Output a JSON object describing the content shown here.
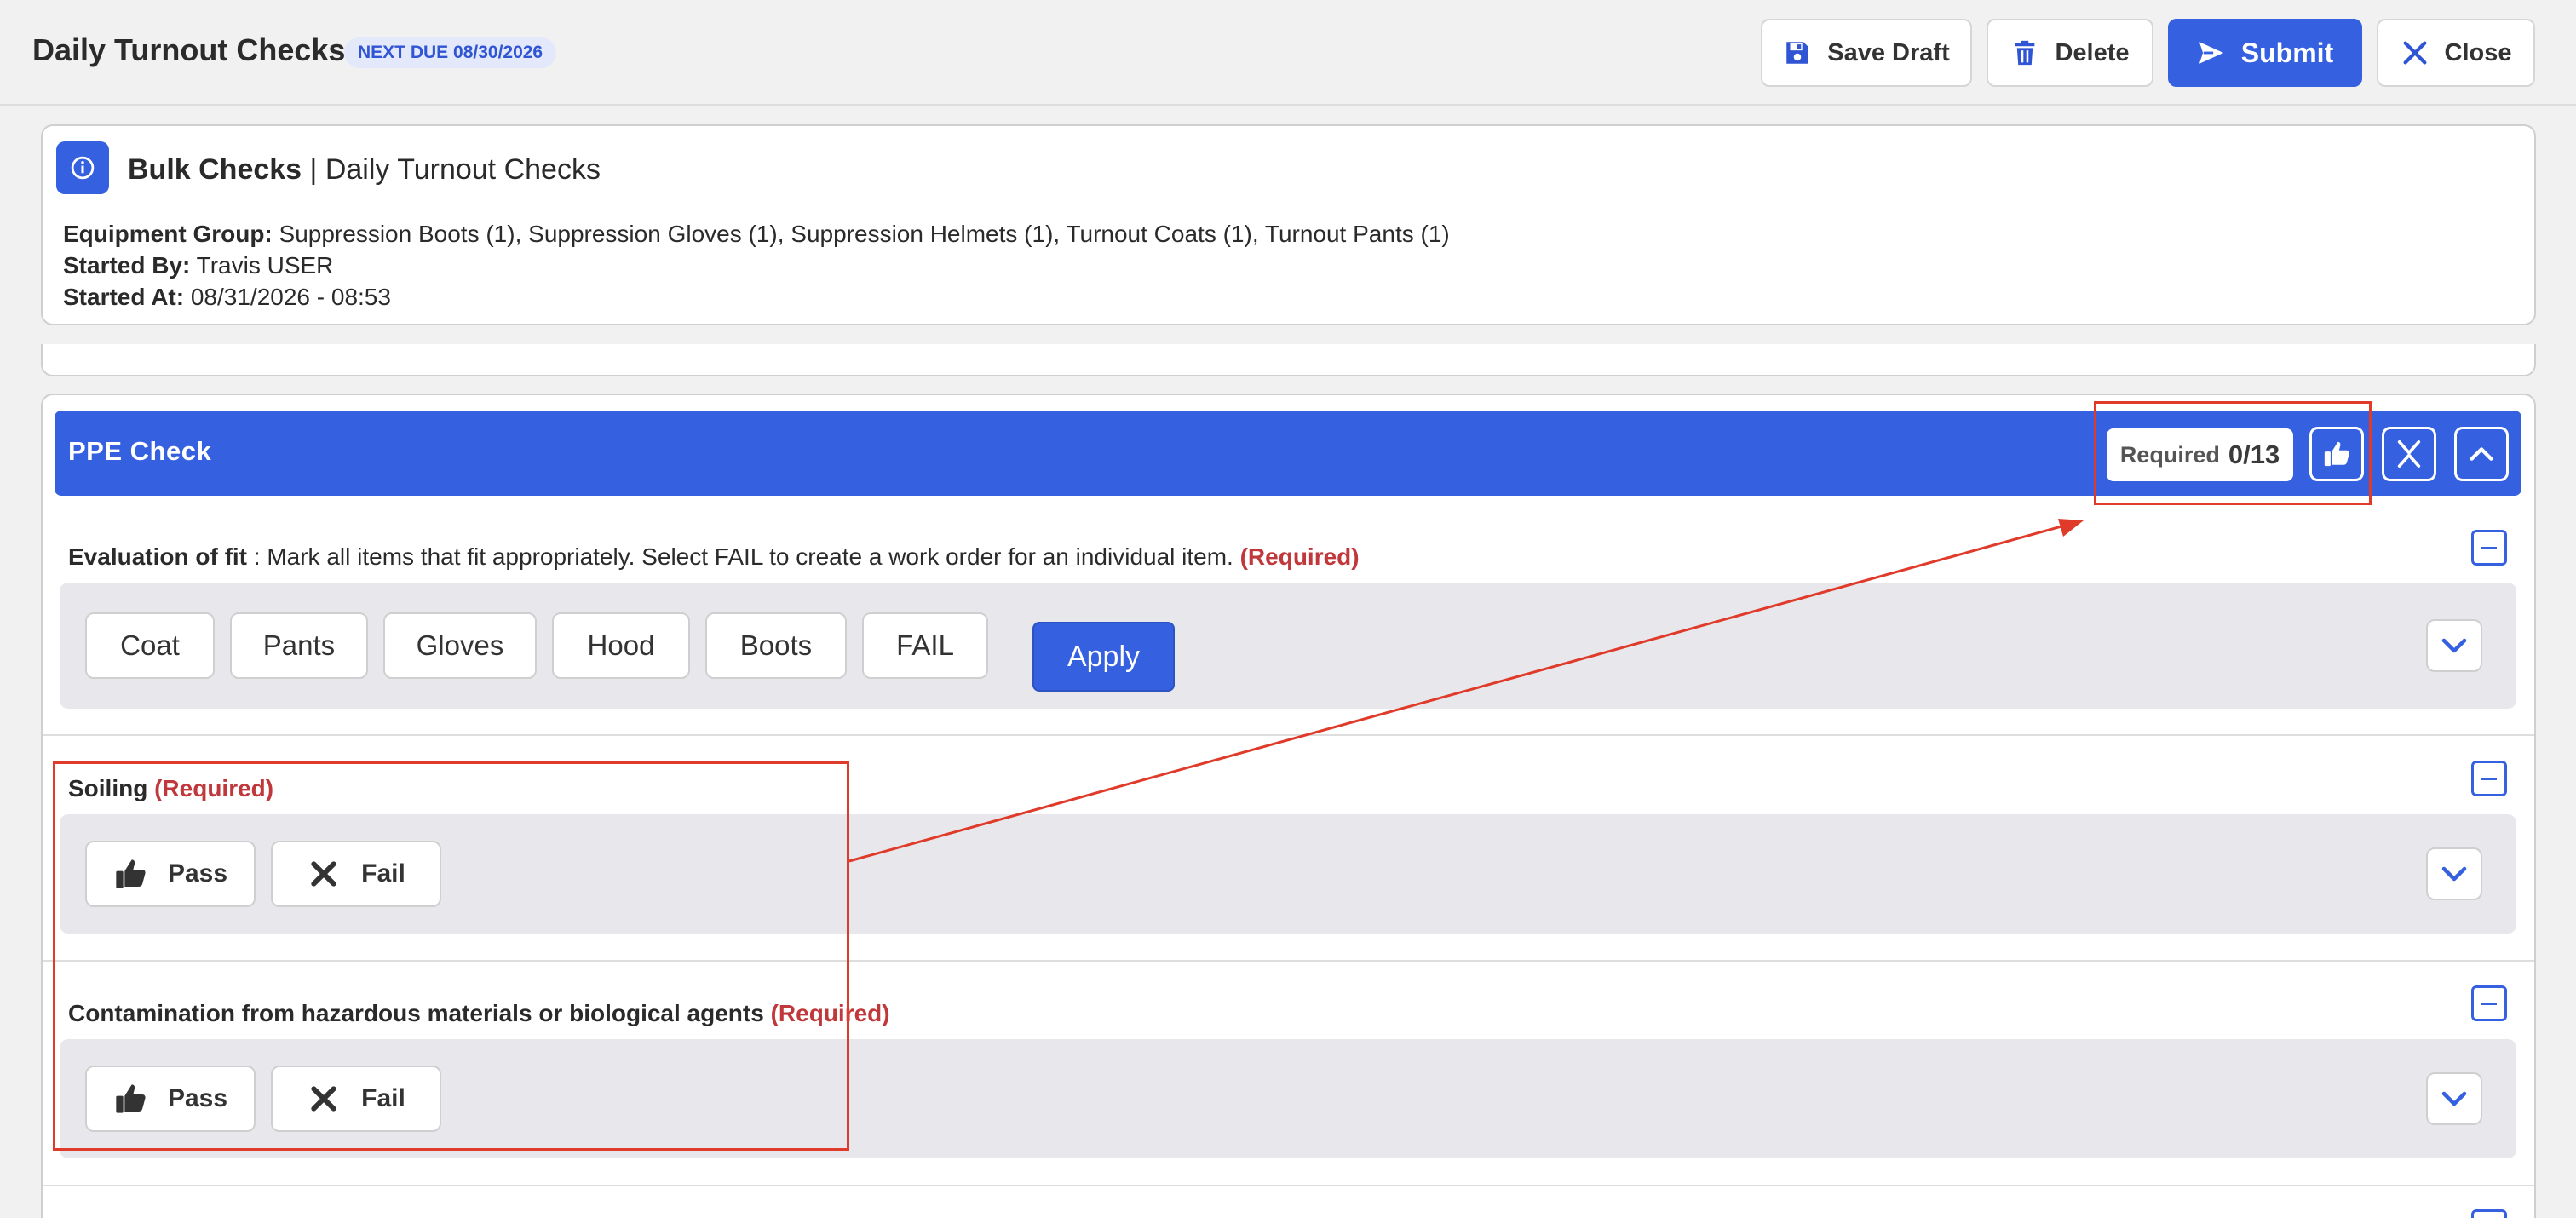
{
  "header": {
    "title": "Daily Turnout Checks",
    "due_badge": "NEXT DUE 08/30/2026",
    "buttons": {
      "save_draft": "Save Draft",
      "delete": "Delete",
      "submit": "Submit",
      "close": "Close"
    }
  },
  "info": {
    "heading_bold": "Bulk Checks",
    "heading_rest": " | Daily Turnout Checks",
    "equipment_group_label": "Equipment Group:",
    "equipment_group_value": " Suppression Boots (1), Suppression Gloves (1), Suppression Helmets (1), Turnout Coats (1), Turnout Pants (1)",
    "started_by_label": "Started By:",
    "started_by_value": " Travis USER",
    "started_at_label": "Started At:",
    "started_at_value": " 08/31/2026 - 08:53"
  },
  "ppe": {
    "title": "PPE Check",
    "required_label": "Required",
    "required_count": "0/13"
  },
  "fit": {
    "label_bold": "Evaluation of fit",
    "label_rest": " : Mark all items that fit appropriately. Select FAIL to create a work order for an individual item. ",
    "required": "(Required)",
    "options": [
      "Coat",
      "Pants",
      "Gloves",
      "Hood",
      "Boots",
      "FAIL"
    ],
    "apply_label": "Apply"
  },
  "soiling": {
    "label": "Soiling",
    "required": " (Required)",
    "pass": "Pass",
    "fail": "Fail"
  },
  "contamination": {
    "label": "Contamination from hazardous materials or biological agents",
    "required": " (Required)",
    "pass": "Pass",
    "fail": "Fail"
  },
  "colors": {
    "accent": "#3560e0",
    "required_red": "#c0383b",
    "annotation_red": "#e03b2a"
  },
  "icons": {
    "save": "floppy-disk-icon",
    "delete": "trash-icon",
    "submit": "paper-plane-icon",
    "close": "x-icon",
    "info": "info-circle-icon",
    "pass": "thumbs-up-icon",
    "fail": "x-icon",
    "expand": "chevron-down-icon",
    "collapse": "chevron-up-icon",
    "minus": "minus-icon"
  }
}
